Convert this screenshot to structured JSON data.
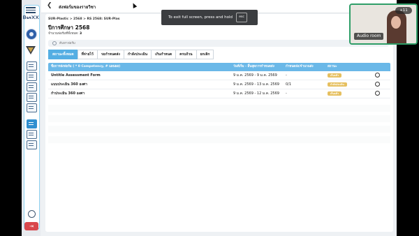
{
  "sidebar": {
    "brand": "ᗷᔕ᙭᙭",
    "logout_label": "⇥"
  },
  "header": {
    "back": "❮",
    "title": "ส่งฟอร์มของรายวิชา"
  },
  "breadcrumb": "SUR-Plastic > 2568 > RS 2568: SUR-Plas",
  "page_title": "ปีการศึกษา 2568",
  "subtitle_label": "จำนวนฟอร์มที่ทั้งหมด: ",
  "subtitle_count": "3",
  "search": {
    "placeholder": "ค้นหาฟอร์ม"
  },
  "tabs": [
    {
      "label": "สถานะทั้งหมด",
      "active": true
    },
    {
      "label": "ที่จ่ายไว้",
      "active": false
    },
    {
      "label": "รอกำหนดส่ง",
      "active": false
    },
    {
      "label": "กำลังประเมิน",
      "active": false
    },
    {
      "label": "เกินกำหนด",
      "active": false
    },
    {
      "label": "ครบถ้วน",
      "active": false
    },
    {
      "label": "ยกเลิก",
      "active": false
    }
  ],
  "table": {
    "headers": [
      "ชื่อการส่งฟอร์ม ( * 0 Competency, # แผนผล)",
      "วันที่เริ่ม - สิ้นสุดการกำหนดส่ง",
      "กำหนดส่ง/จำนวนส่ง",
      "สถานะ"
    ],
    "rows": [
      {
        "name": "Untitle Assessment Form",
        "dates": "9 ม.ค. 2569 - 9 ม.ค. 2569",
        "progress": "-",
        "status": "เก็บแล้ว",
        "status_color": "#e6c060"
      },
      {
        "name": "แบบประเมิน 360 องศา",
        "dates": "9 ม.ค. 2569 - 13 ม.ค. 2569",
        "progress": "0/1",
        "status": "กำลังประเมิน",
        "status_color": "#e6c060"
      },
      {
        "name": "กำประเมิน 360 องศา",
        "dates": "9 ม.ค. 2569 - 12 ม.ค. 2569",
        "progress": "-",
        "status": "เก็บแล้ว",
        "status_color": "#e6c060"
      }
    ]
  },
  "toast": {
    "message": "To exit full screen, press and hold",
    "key": "esc"
  },
  "video": {
    "participants": "+11",
    "label": "Audio room"
  },
  "colors": {
    "accent": "#54aee3",
    "header": "#6ab8e8",
    "badge": "#e6c060",
    "call_border": "#2f9e68"
  }
}
